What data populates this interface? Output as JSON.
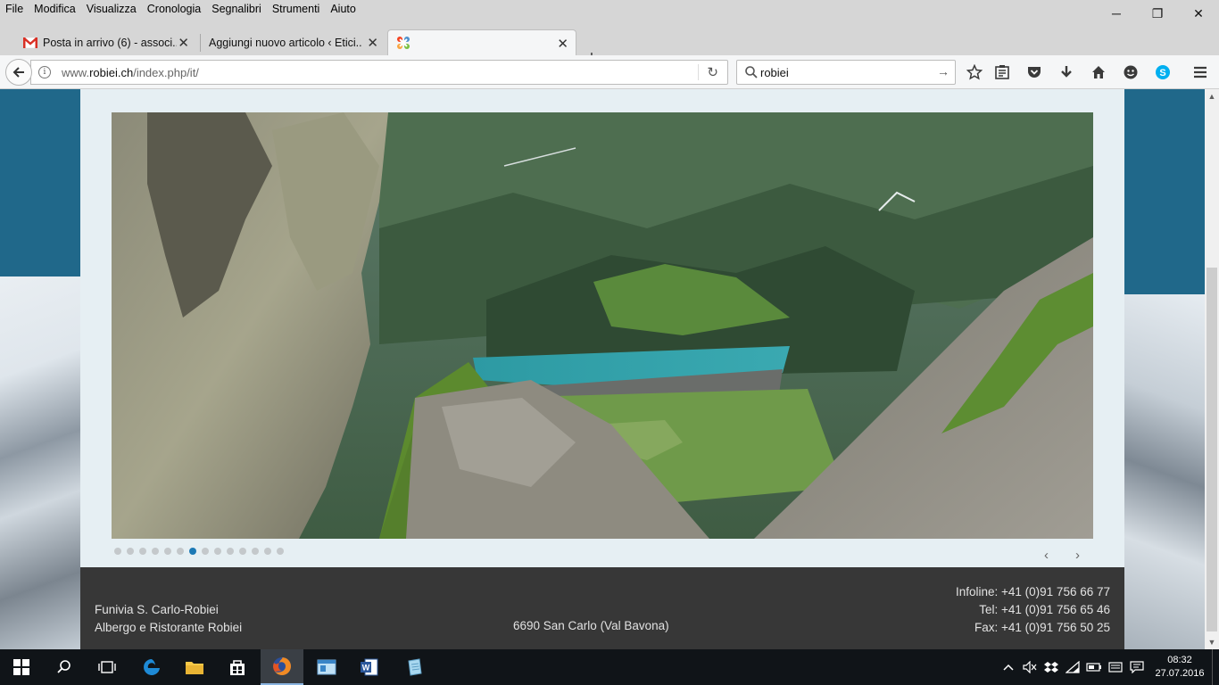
{
  "menubar": {
    "items": [
      "File",
      "Modifica",
      "Visualizza",
      "Cronologia",
      "Segnalibri",
      "Strumenti",
      "Aiuto"
    ]
  },
  "window_controls": {
    "minimize": "─",
    "restore": "❐",
    "close": "✕"
  },
  "tabs": [
    {
      "title": "Posta in arrivo (6) - associ...",
      "icon": "gmail-icon",
      "close": "✕"
    },
    {
      "title": "Aggiungi nuovo articolo ‹ Etici...",
      "icon": "none",
      "close": "✕"
    },
    {
      "title": "",
      "icon": "joomla-icon",
      "close": "✕"
    }
  ],
  "new_tab": "+",
  "navbar": {
    "url_prefix": "www.",
    "url_host": "robiei.ch",
    "url_path": "/index.php/it/",
    "search_value": "robiei",
    "search_go": "→",
    "reload": "↻"
  },
  "slider": {
    "dot_count": 14,
    "active_dot": 6,
    "prev": "‹",
    "next": "›"
  },
  "footer": {
    "left_line1": "Funivia S. Carlo-Robiei",
    "left_line2": "Albergo e Ristorante Robiei",
    "center": "6690 San Carlo (Val Bavona)",
    "infoline": "Infoline: +41 (0)91 756 66 77",
    "tel": "Tel: +41 (0)91 756 65 46",
    "fax": "Fax: +41 (0)91 756 50 25"
  },
  "scrollbar": {
    "up": "▲",
    "down": "▼"
  },
  "taskbar": {
    "clock_time": "08:32",
    "clock_date": "27.07.2016"
  },
  "colors": {
    "accent": "#1c79b5",
    "footer_bg": "#373737",
    "page_bg": "#20688a"
  }
}
